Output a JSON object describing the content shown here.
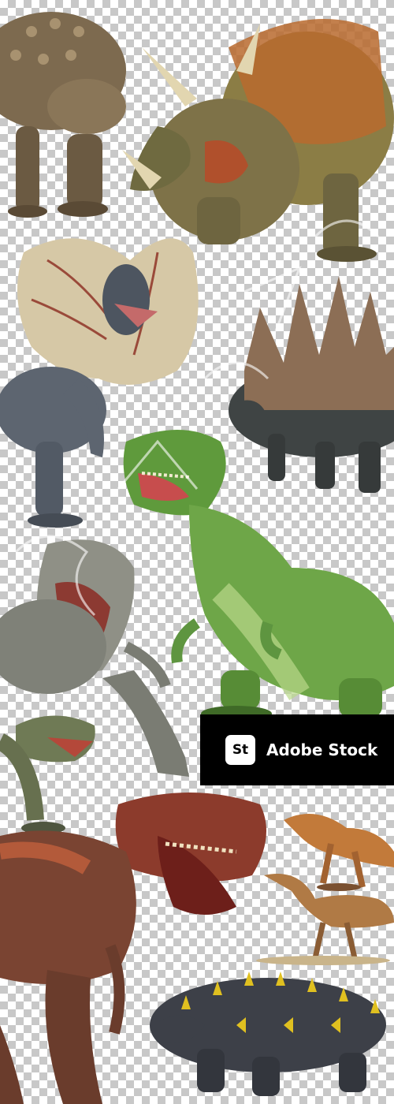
{
  "image": {
    "background": "transparency-checkerboard",
    "subjects": [
      "ankylosaurus",
      "triceratops",
      "dilophosaurus",
      "stegosaurus",
      "green-tyrannosaurus",
      "grey-tyrannosaurus",
      "small-raptor-head",
      "red-tyrannosaurus",
      "velociraptor",
      "long-neck-dinosaur",
      "spiked-ankylosaurus"
    ]
  },
  "badge": {
    "logo": "St",
    "label": "Adobe Stock"
  },
  "watermark_text": "",
  "colors": {
    "badge_bg": "#000000",
    "badge_text": "#ffffff"
  }
}
